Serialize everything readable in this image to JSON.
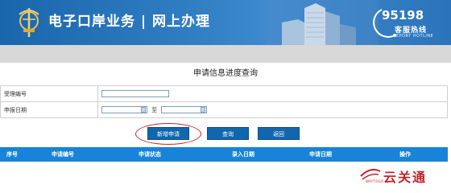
{
  "header": {
    "site_title": "电子口岸业务 | 网上办理",
    "hotline_number": "95198",
    "hotline_label_cn": "客服热线",
    "hotline_label_en": "EPORT HOTLINE"
  },
  "page_title": "申请信息进度查询",
  "form": {
    "accept_no_label": "受理编号",
    "accept_no_value": "",
    "apply_date_label": "申报日期",
    "date_from_value": "",
    "date_to_label": "至",
    "date_to_value": ""
  },
  "buttons": {
    "new_application": "新增申请",
    "query": "查询",
    "back": "返回"
  },
  "list": {
    "columns": [
      "序号",
      "申请编号",
      "申请状态",
      "录入日期",
      "申请日期",
      "操作"
    ]
  },
  "watermark": {
    "text": "云关通",
    "text_en": "WAYTOGO"
  },
  "colors": {
    "header_blue": "#1a66ad",
    "button_blue": "#1167ad",
    "list_header_blue": "#1883d8",
    "highlight_red": "#d21f1f"
  }
}
